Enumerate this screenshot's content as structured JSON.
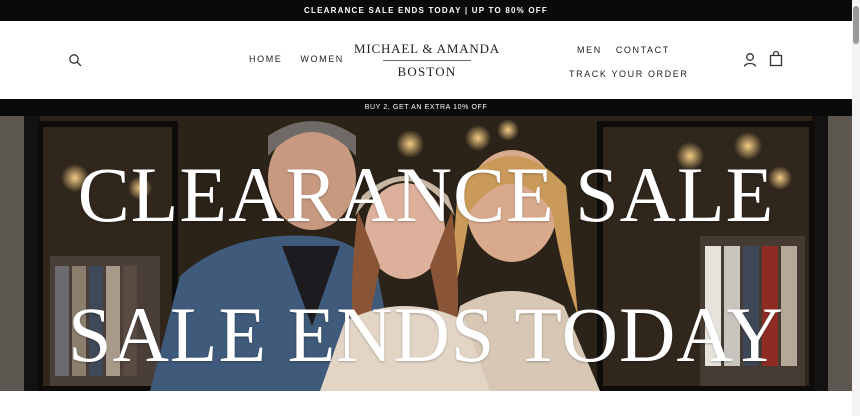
{
  "announcement": {
    "text": "CLEARANCE SALE ENDS TODAY | UP TO 80% OFF"
  },
  "header": {
    "nav_left": [
      "HOME",
      "WOMEN"
    ],
    "logo": {
      "line1": "MICHAEL & AMANDA",
      "line2": "BOSTON"
    },
    "nav_right": [
      "MEN",
      "CONTACT",
      "TRACK YOUR ORDER"
    ]
  },
  "promo": {
    "text": "BUY 2, GET AN EXTRA 10% OFF"
  },
  "hero": {
    "line1": "CLEARANCE SALE",
    "line2": "SALE ENDS TODAY"
  },
  "icons": [
    "search-icon",
    "account-icon",
    "cart-icon"
  ],
  "colors": {
    "bar_black": "#0a0a0a",
    "header_white": "#ffffff",
    "text_dark": "#222222"
  }
}
